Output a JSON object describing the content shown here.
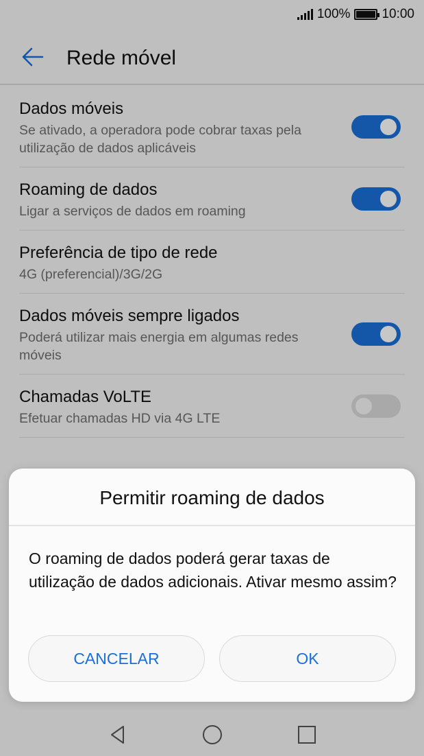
{
  "status_bar": {
    "battery": "100%",
    "time": "10:00"
  },
  "header": {
    "title": "Rede móvel"
  },
  "settings": [
    {
      "title": "Dados móveis",
      "subtitle": "Se ativado, a operadora pode cobrar taxas pela utilização de dados aplicáveis",
      "toggle": true
    },
    {
      "title": "Roaming de dados",
      "subtitle": "Ligar a serviços de dados em roaming",
      "toggle": true
    },
    {
      "title": "Preferência de tipo de rede",
      "subtitle": "4G (preferencial)/3G/2G",
      "toggle": null
    },
    {
      "title": "Dados móveis sempre ligados",
      "subtitle": "Poderá utilizar mais energia em algumas redes móveis",
      "toggle": true
    },
    {
      "title": "Chamadas VoLTE",
      "subtitle": "Efetuar chamadas HD via 4G LTE",
      "toggle": false
    }
  ],
  "dialog": {
    "title": "Permitir roaming de dados",
    "message": "O roaming de dados poderá gerar taxas de utilização de dados adicionais. Ativar mesmo assim?",
    "cancel_label": "CANCELAR",
    "ok_label": "OK"
  },
  "colors": {
    "accent": "#1a6fd8",
    "toggle_off": "#d9d9d9"
  },
  "icons": {
    "back": "arrow-left-icon",
    "nav_back": "triangle-back-icon",
    "nav_home": "circle-home-icon",
    "nav_recents": "square-recents-icon"
  }
}
